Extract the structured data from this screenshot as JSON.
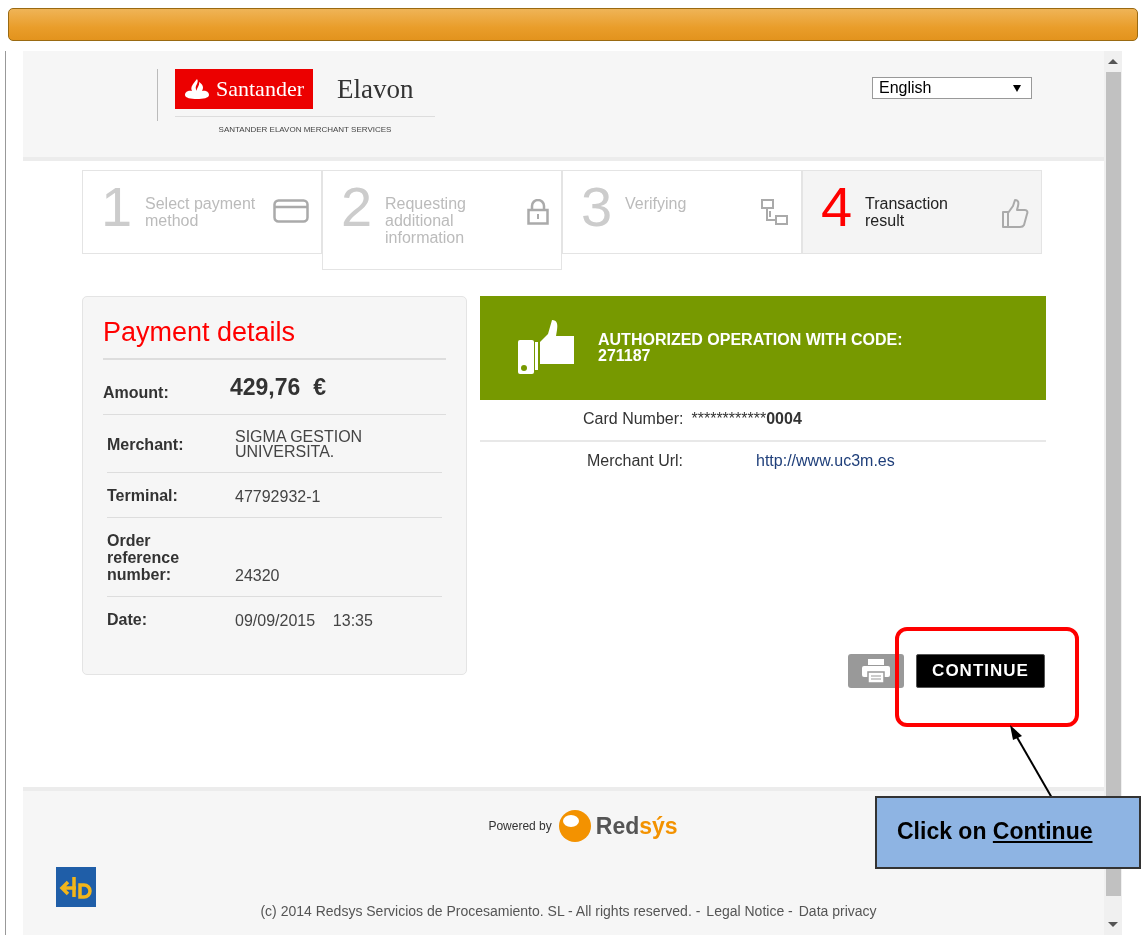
{
  "header": {
    "bank_logo": "Santander",
    "partner_logo": "Elavon",
    "tagline": "SANTANDER ELAVON MERCHANT SERVICES",
    "language": "English"
  },
  "steps": [
    {
      "number": "1",
      "label": "Select payment method",
      "selected": false,
      "kind": "card"
    },
    {
      "number": "2",
      "label": "Requesting additional information",
      "selected": false,
      "kind": "lock"
    },
    {
      "number": "3",
      "label": "Verifying",
      "selected": false,
      "kind": "network"
    },
    {
      "number": "4",
      "label": "Transaction result",
      "selected": true,
      "kind": "thumb"
    }
  ],
  "payment_details": {
    "title": "Payment details",
    "amount_label": "Amount:",
    "amount": "429,76",
    "currency": "€",
    "rows": [
      {
        "label": "Merchant:",
        "value": "SIGMA GESTION UNIVERSITA."
      },
      {
        "label": "Terminal:",
        "value": "47792932-1"
      },
      {
        "label": "Order reference number:",
        "value": "24320"
      },
      {
        "label": "Date:",
        "value": "09/09/2015",
        "time": "13:35"
      }
    ]
  },
  "result": {
    "message": "AUTHORIZED OPERATION WITH CODE: 271187",
    "card_label": "Card Number:",
    "card_masked": "************",
    "card_last": "0004",
    "url_label": "Merchant Url:",
    "url": "http://www.uc3m.es"
  },
  "buttons": {
    "continue": "CONTINUE"
  },
  "footer": {
    "powered_by": "Powered by",
    "brand_dark": "Red",
    "brand_light": "sýs",
    "copyright": "(c) 2014 Redsys Servicios de Procesamiento. SL - All rights reserved. -",
    "links": [
      "Legal Notice -",
      "Data privacy"
    ]
  },
  "callout": {
    "text": "Click on",
    "emphasis": "Continue"
  }
}
